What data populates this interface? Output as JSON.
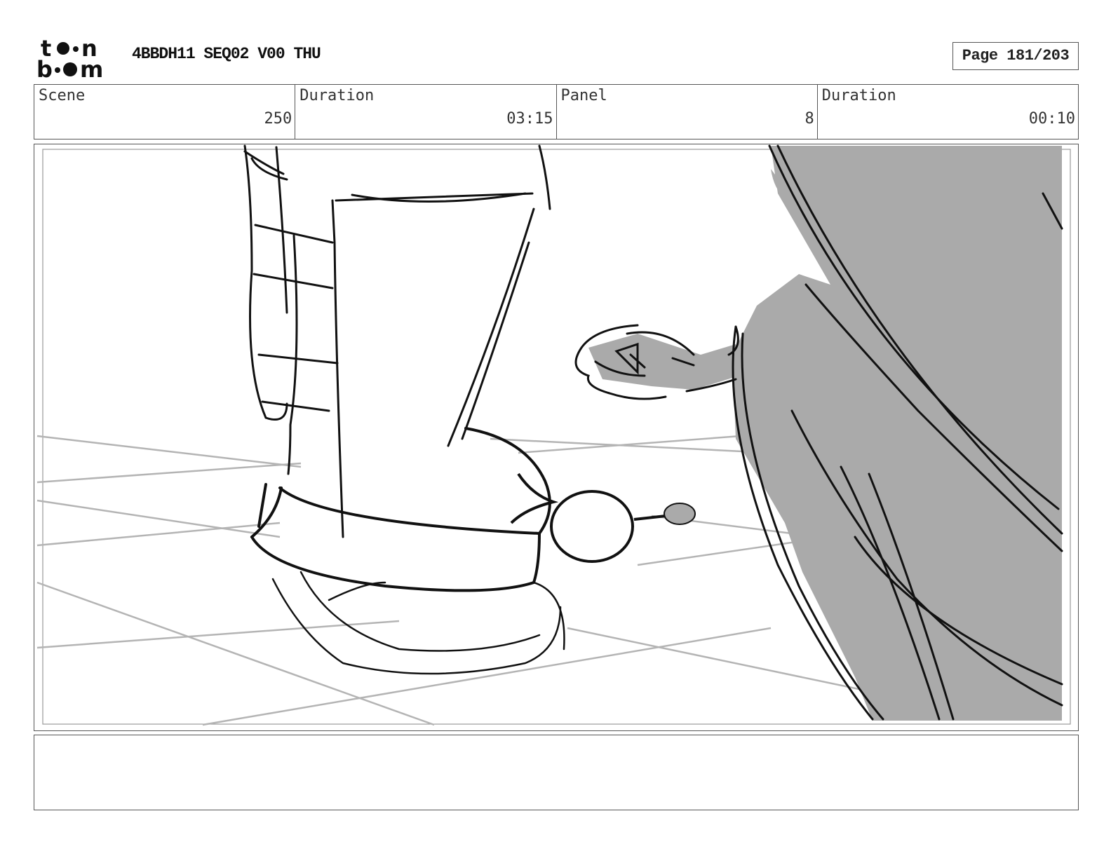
{
  "header": {
    "logo_top": "to•n",
    "logo_bottom": "b••m",
    "title": "4BBDH11 SEQ02 V00 THU",
    "page_label": "Page 181/203"
  },
  "info": [
    {
      "label": "Scene",
      "value": "250"
    },
    {
      "label": "Duration",
      "value": "03:15"
    },
    {
      "label": "Panel",
      "value": "8"
    },
    {
      "label": "Duration",
      "value": "00:10"
    }
  ],
  "colors": {
    "ink": "#111111",
    "shadow_fill": "#aaaaaa",
    "floor_lines": "#b4b4b4",
    "frame": "#555555"
  },
  "notes": ""
}
